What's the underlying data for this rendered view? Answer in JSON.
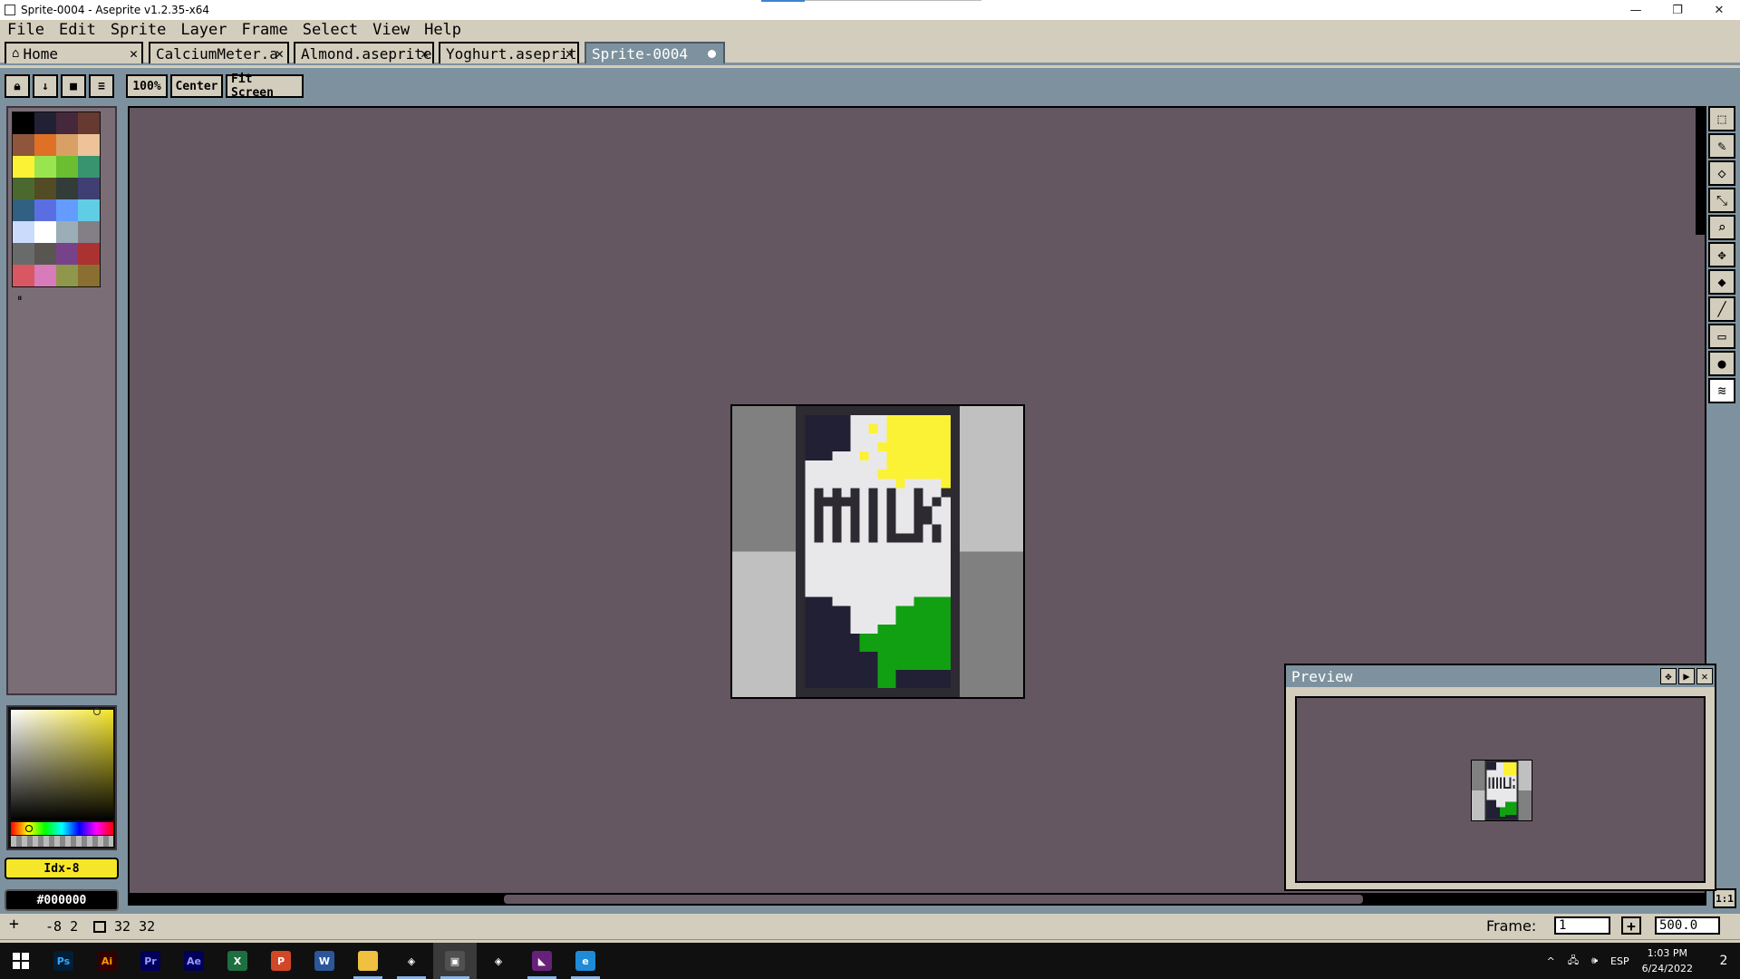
{
  "window": {
    "title": "Sprite-0004 - Aseprite v1.2.35-x64"
  },
  "menu": [
    "File",
    "Edit",
    "Sprite",
    "Layer",
    "Frame",
    "Select",
    "View",
    "Help"
  ],
  "tabs": [
    {
      "label": "Home"
    },
    {
      "label": "CalciumMeter.a"
    },
    {
      "label": "Almond.aseprite"
    },
    {
      "label": "Yoghurt.aseprit"
    },
    {
      "label": "Sprite-0004"
    }
  ],
  "context_bar": {
    "zoom": "100%",
    "center": "Center",
    "fit": "Fit Screen"
  },
  "palette": {
    "colors": [
      "#000000",
      "#222034",
      "#45283c",
      "#663931",
      "#8f563b",
      "#df7126",
      "#d9a066",
      "#eec39a",
      "#fbf236",
      "#99e550",
      "#6abe30",
      "#37946e",
      "#4b692f",
      "#524b24",
      "#323c39",
      "#3f3f74",
      "#306082",
      "#5b6ee1",
      "#639bff",
      "#5fcde4",
      "#cbdbfc",
      "#ffffff",
      "#9badb7",
      "#847e87",
      "#696a6a",
      "#595652",
      "#76428a",
      "#ac3232",
      "#d95763",
      "#d77bba",
      "#8f974a",
      "#8a6f30"
    ]
  },
  "colors": {
    "foreground_label": "Idx-8",
    "foreground": "#fbf236",
    "background_label": "#000000",
    "background": "#000000"
  },
  "tools": [
    "marquee-icon",
    "pencil-icon",
    "eraser-icon",
    "eyedropper-icon",
    "zoom-icon",
    "move-icon",
    "fill-icon",
    "line-icon",
    "rectangle-icon",
    "contour-icon",
    "blur-icon"
  ],
  "preview": {
    "title": "Preview"
  },
  "sprite": {
    "text": "MILK"
  },
  "status": {
    "position": "-8 2",
    "size": "32 32",
    "frame_label": "Frame:",
    "frame_value": "1",
    "zoom_value": "500.0"
  },
  "one_to_one": "1:1",
  "taskbar": {
    "apps": [
      {
        "name": "photoshop",
        "label": "Ps",
        "color": "#31a8ff",
        "bg": "#001e36"
      },
      {
        "name": "illustrator",
        "label": "Ai",
        "color": "#ff9a00",
        "bg": "#330000"
      },
      {
        "name": "premiere",
        "label": "Pr",
        "color": "#9999ff",
        "bg": "#00005b"
      },
      {
        "name": "after-effects",
        "label": "Ae",
        "color": "#9999ff",
        "bg": "#00005b"
      },
      {
        "name": "excel",
        "label": "X",
        "color": "#ffffff",
        "bg": "#1d6f42"
      },
      {
        "name": "powerpoint",
        "label": "P",
        "color": "#ffffff",
        "bg": "#d24726"
      },
      {
        "name": "word",
        "label": "W",
        "color": "#ffffff",
        "bg": "#2b579a"
      },
      {
        "name": "file-explorer",
        "label": "",
        "color": "#ffffff",
        "bg": "#f0c040"
      },
      {
        "name": "unity",
        "label": "◈",
        "color": "#ffffff",
        "bg": "#101010"
      },
      {
        "name": "aseprite",
        "label": "▣",
        "color": "#ffffff",
        "bg": "#505050"
      },
      {
        "name": "unity-hub",
        "label": "◈",
        "color": "#ffffff",
        "bg": "#101010"
      },
      {
        "name": "visual-studio",
        "label": "◣",
        "color": "#ffffff",
        "bg": "#68217a"
      },
      {
        "name": "edge",
        "label": "e",
        "color": "#ffffff",
        "bg": "#1f8ad6"
      }
    ],
    "language": "ESP",
    "time": "1:03 PM",
    "date": "6/24/2022",
    "notifications": "2"
  }
}
